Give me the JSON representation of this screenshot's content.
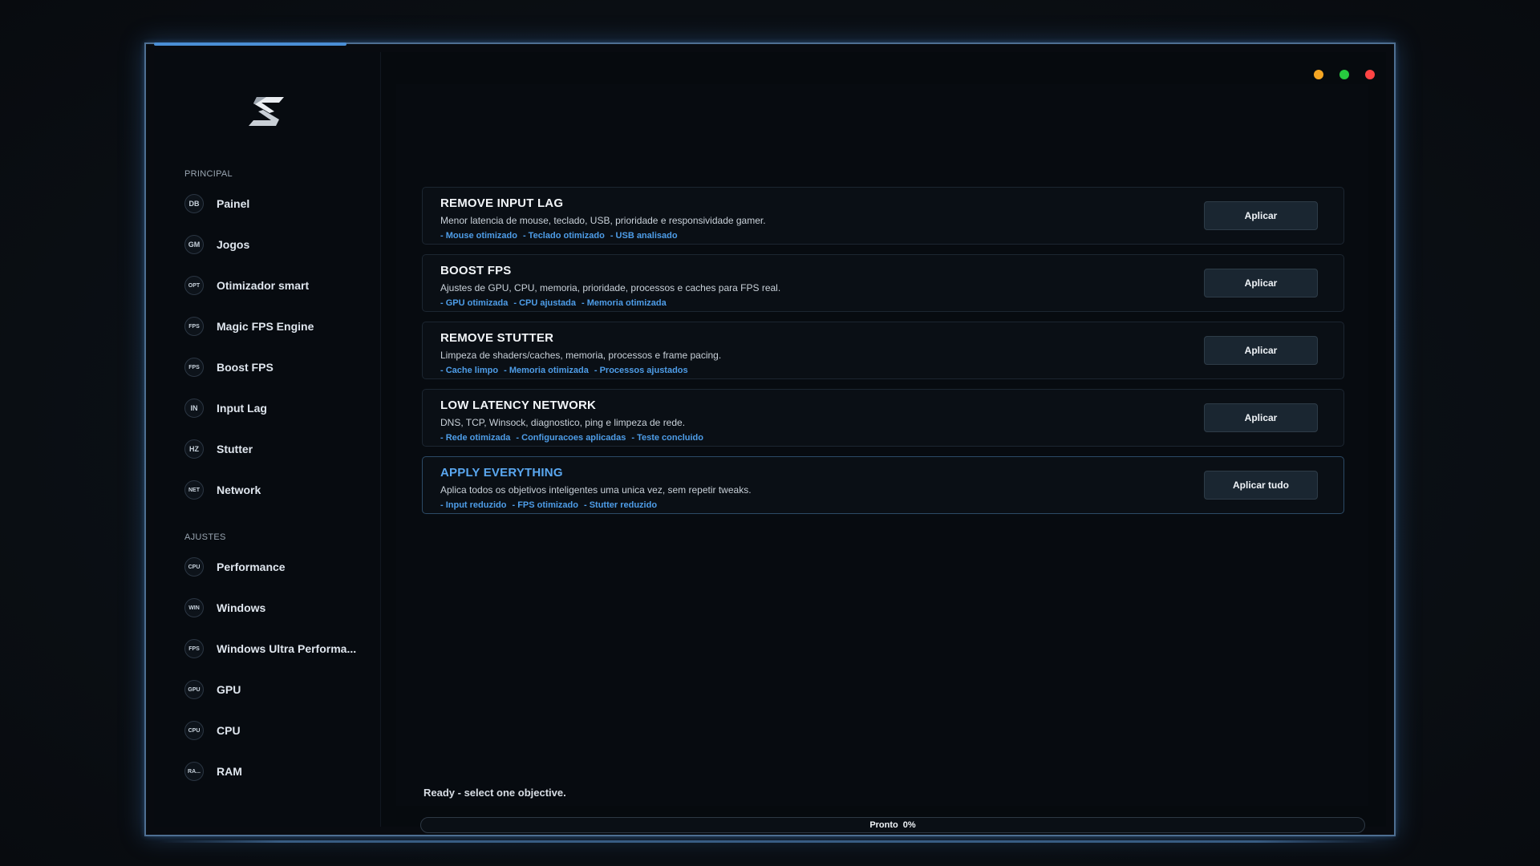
{
  "sidebar": {
    "logo": "s-logo-icon",
    "sections": [
      {
        "label": "PRINCIPAL",
        "items": [
          {
            "icon": "DB",
            "label": "Painel"
          },
          {
            "icon": "GM",
            "label": "Jogos"
          },
          {
            "icon": "OPT",
            "label": "Otimizador smart"
          },
          {
            "icon": "FPS",
            "label": "Magic FPS Engine"
          },
          {
            "icon": "FPS",
            "label": "Boost FPS"
          },
          {
            "icon": "IN",
            "label": "Input Lag"
          },
          {
            "icon": "HZ",
            "label": "Stutter"
          },
          {
            "icon": "NET",
            "label": "Network"
          }
        ]
      },
      {
        "label": "AJUSTES",
        "items": [
          {
            "icon": "CPU",
            "label": "Performance"
          },
          {
            "icon": "WIN",
            "label": "Windows"
          },
          {
            "icon": "FPS",
            "label": "Windows Ultra Performa..."
          },
          {
            "icon": "GPU",
            "label": "GPU"
          },
          {
            "icon": "CPU",
            "label": "CPU"
          },
          {
            "icon": "RA...",
            "label": "RAM"
          }
        ]
      }
    ]
  },
  "window_controls": {
    "colors": {
      "minimize": "#f5a623",
      "maximize": "#27c93f",
      "close": "#ff4444"
    }
  },
  "cards": [
    {
      "title": "REMOVE INPUT LAG",
      "description": "Menor latencia de mouse, teclado, USB, prioridade e responsividade gamer.",
      "tags": [
        "- Mouse otimizado",
        "- Teclado otimizado",
        "- USB analisado"
      ],
      "button": "Aplicar",
      "highlight": false
    },
    {
      "title": "BOOST FPS",
      "description": "Ajustes de GPU, CPU, memoria, prioridade, processos e caches para FPS real.",
      "tags": [
        "- GPU otimizada",
        "- CPU ajustada",
        "- Memoria otimizada"
      ],
      "button": "Aplicar",
      "highlight": false
    },
    {
      "title": "REMOVE STUTTER",
      "description": "Limpeza de shaders/caches, memoria, processos e frame pacing.",
      "tags": [
        "- Cache limpo",
        "- Memoria otimizada",
        "- Processos ajustados"
      ],
      "button": "Aplicar",
      "highlight": false
    },
    {
      "title": "LOW LATENCY NETWORK",
      "description": "DNS, TCP, Winsock, diagnostico, ping e limpeza de rede.",
      "tags": [
        "- Rede otimizada",
        "- Configuracoes aplicadas",
        "- Teste concluido"
      ],
      "button": "Aplicar",
      "highlight": false
    },
    {
      "title": "APPLY EVERYTHING",
      "description": "Aplica todos os objetivos inteligentes uma unica vez, sem repetir tweaks.",
      "tags": [
        "- Input reduzido",
        "- FPS otimizado",
        "- Stutter reduzido"
      ],
      "button": "Aplicar tudo",
      "highlight": true
    }
  ],
  "status": {
    "message": "Ready - select one objective.",
    "progress_label": "Pronto",
    "progress_percent_text": "0%",
    "progress_value": 0
  },
  "colors": {
    "accent": "#4e9de8",
    "highlight_title": "#5aa7f0",
    "window_border": "#4e6f92"
  }
}
